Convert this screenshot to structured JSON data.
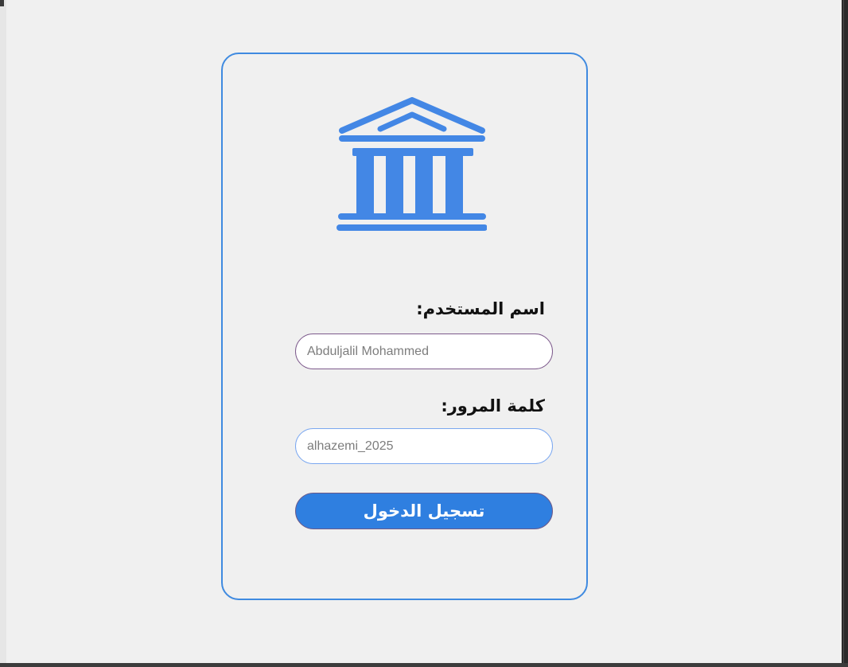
{
  "login": {
    "logo_icon": "bank-building-icon",
    "username_label": "اسم المستخدم:",
    "username_value": "Abduljalil Mohammed",
    "password_label": "كلمة المرور:",
    "password_value": "alhazemi_2025",
    "submit_label": "تسجيل الدخول"
  },
  "colors": {
    "accent": "#3f8ae0",
    "button": "#2f7fe0",
    "background": "#f0f0f0"
  }
}
